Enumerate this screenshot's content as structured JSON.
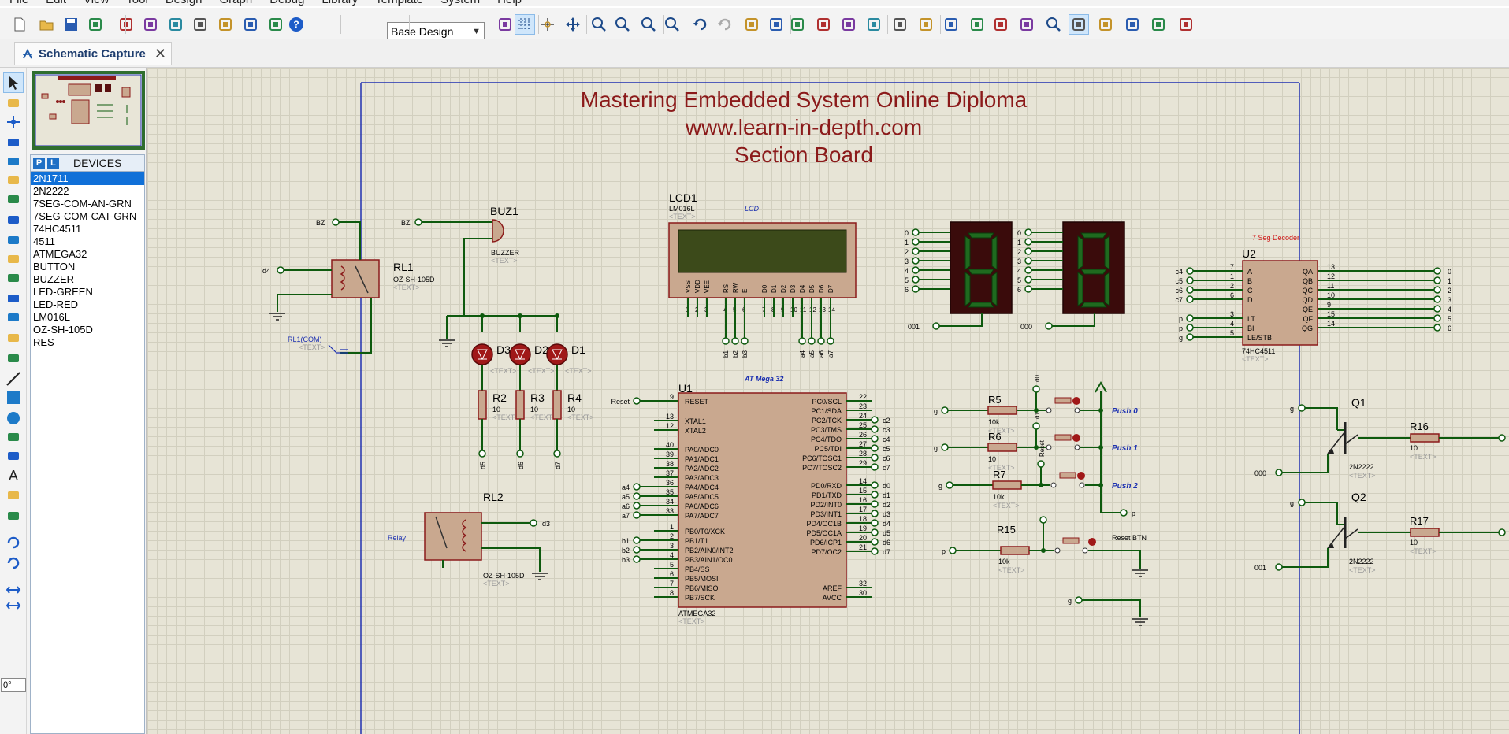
{
  "menu": [
    "File",
    "Edit",
    "View",
    "Tool",
    "Design",
    "Graph",
    "Debug",
    "Library",
    "Template",
    "System",
    "Help"
  ],
  "toolbar": {
    "design_select": "Base Design",
    "icons": [
      "new-file-icon",
      "open-folder-icon",
      "save-icon",
      "import-icon",
      "home-icon",
      "component-icon",
      "audio-icon",
      "bom-icon",
      "price-icon",
      "board-icon",
      "netlist-icon",
      "help-icon",
      "refresh-icon",
      "grid-icon",
      "origin-icon",
      "pan-icon",
      "zoom-in-icon",
      "zoom-out-icon",
      "zoom-fit-icon",
      "zoom-area-icon",
      "undo-icon",
      "redo-icon",
      "cut-icon",
      "copy-icon",
      "paste-icon",
      "block-copy-icon",
      "block-move-icon",
      "block-rotate-icon",
      "block-delete-icon",
      "pick-device-icon",
      "make-device-icon",
      "packaging-icon",
      "decompose-icon",
      "wire-autorouter-icon",
      "search-icon",
      "property-tool-icon",
      "new-sheet-icon",
      "remove-sheet-icon",
      "exit-parent-icon",
      "netlist-to-ares-icon"
    ]
  },
  "tabs": [
    {
      "label": "Schematic Capture"
    }
  ],
  "devices": {
    "header": "DEVICES",
    "p_label": "P",
    "l_label": "L",
    "items": [
      "2N1711",
      "2N2222",
      "7SEG-COM-AN-GRN",
      "7SEG-COM-CAT-GRN",
      "74HC4511",
      "4511",
      "ATMEGA32",
      "BUTTON",
      "BUZZER",
      "LED-GREEN",
      "LED-RED",
      "LM016L",
      "OZ-SH-105D",
      "RES"
    ],
    "selected": "2N1711"
  },
  "left_tools": {
    "angle_value": "0°",
    "icons": [
      "selection-icon",
      "component-mode-icon",
      "junction-dot-icon",
      "wire-label-icon",
      "text-script-icon",
      "bus-icon",
      "subcircuit-icon",
      "terminal-icon",
      "device-pin-icon",
      "graph-icon",
      "tape-recorder-icon",
      "generator-icon",
      "voltage-probe-icon",
      "current-probe-icon",
      "virtual-instrument-icon",
      "line-icon",
      "box-icon",
      "circle-icon",
      "arc-icon",
      "path-icon",
      "text-icon",
      "symbol-icon",
      "marker-icon",
      "rotate-cw-icon",
      "rotate-ccw-icon",
      "mirror-x-icon",
      "mirror-y-icon"
    ]
  },
  "schematic": {
    "title_lines": [
      "Mastering Embedded System Online Diploma",
      "www.learn-in-depth.com",
      "Section Board"
    ],
    "text_placeholder": "<TEXT>",
    "lcd": {
      "ref": "LCD1",
      "part": "LM016L",
      "label": "LCD",
      "pins": [
        "VSS",
        "VDD",
        "VEE",
        "RS",
        "RW",
        "E",
        "D0",
        "D1",
        "D2",
        "D3",
        "D4",
        "D5",
        "D6",
        "D7"
      ],
      "pin_nums": [
        "1",
        "2",
        "3",
        "4",
        "5",
        "6",
        "7",
        "8",
        "9",
        "10",
        "11",
        "12",
        "13",
        "14"
      ],
      "net_labels": [
        "b1",
        "b2",
        "b3",
        "a4",
        "a5",
        "a6",
        "a7"
      ]
    },
    "buzzer": {
      "ref": "BUZ1",
      "part": "BUZZER",
      "net": "BZ"
    },
    "relay1": {
      "ref": "RL1",
      "part": "OZ-SH-105D",
      "in_net": "d4",
      "bz_net": "BZ",
      "com_label": "RL1(COM)"
    },
    "relay2": {
      "ref": "RL2",
      "part": "OZ-SH-105D",
      "label": "Relay",
      "out_net": "d3"
    },
    "leds": [
      {
        "ref": "D3"
      },
      {
        "ref": "D2"
      },
      {
        "ref": "D1"
      }
    ],
    "resistors_led": [
      {
        "ref": "R2",
        "value": "10",
        "net": "d5"
      },
      {
        "ref": "R3",
        "value": "10",
        "net": "d6"
      },
      {
        "ref": "R4",
        "value": "10",
        "net": "d7"
      }
    ],
    "mcu": {
      "ref": "U1",
      "part": "ATMEGA32",
      "label": "AT Mega 32",
      "left_pins": [
        {
          "name": "RESET",
          "num": "9",
          "net": "Reset"
        },
        {
          "name": "XTAL1",
          "num": "13",
          "net": ""
        },
        {
          "name": "XTAL2",
          "num": "12",
          "net": ""
        },
        {
          "name": "PA0/ADC0",
          "num": "40",
          "net": ""
        },
        {
          "name": "PA1/ADC1",
          "num": "39",
          "net": ""
        },
        {
          "name": "PA2/ADC2",
          "num": "38",
          "net": ""
        },
        {
          "name": "PA3/ADC3",
          "num": "37",
          "net": ""
        },
        {
          "name": "PA4/ADC4",
          "num": "36",
          "net": "a4"
        },
        {
          "name": "PA5/ADC5",
          "num": "35",
          "net": "a5"
        },
        {
          "name": "PA6/ADC6",
          "num": "34",
          "net": "a6"
        },
        {
          "name": "PA7/ADC7",
          "num": "33",
          "net": "a7"
        },
        {
          "name": "PB0/T0/XCK",
          "num": "1",
          "net": ""
        },
        {
          "name": "PB1/T1",
          "num": "2",
          "net": "b1"
        },
        {
          "name": "PB2/AIN0/INT2",
          "num": "3",
          "net": "b2"
        },
        {
          "name": "PB3/AIN1/OC0",
          "num": "4",
          "net": "b3"
        },
        {
          "name": "PB4/SS",
          "num": "5",
          "net": ""
        },
        {
          "name": "PB5/MOSI",
          "num": "6",
          "net": ""
        },
        {
          "name": "PB6/MISO",
          "num": "7",
          "net": ""
        },
        {
          "name": "PB7/SCK",
          "num": "8",
          "net": ""
        }
      ],
      "right_pins": [
        {
          "name": "PC0/SCL",
          "num": "22",
          "net": ""
        },
        {
          "name": "PC1/SDA",
          "num": "23",
          "net": ""
        },
        {
          "name": "PC2/TCK",
          "num": "24",
          "net": "c2"
        },
        {
          "name": "PC3/TMS",
          "num": "25",
          "net": "c3"
        },
        {
          "name": "PC4/TDO",
          "num": "26",
          "net": "c4"
        },
        {
          "name": "PC5/TDI",
          "num": "27",
          "net": "c5"
        },
        {
          "name": "PC6/TOSC1",
          "num": "28",
          "net": "c6"
        },
        {
          "name": "PC7/TOSC2",
          "num": "29",
          "net": "c7"
        },
        {
          "name": "PD0/RXD",
          "num": "14",
          "net": "d0"
        },
        {
          "name": "PD1/TXD",
          "num": "15",
          "net": "d1"
        },
        {
          "name": "PD2/INT0",
          "num": "16",
          "net": "d2"
        },
        {
          "name": "PD3/INT1",
          "num": "17",
          "net": "d3"
        },
        {
          "name": "PD4/OC1B",
          "num": "18",
          "net": "d4"
        },
        {
          "name": "PD5/OC1A",
          "num": "19",
          "net": "d5"
        },
        {
          "name": "PD6/ICP1",
          "num": "20",
          "net": "d6"
        },
        {
          "name": "PD7/OC2",
          "num": "21",
          "net": "d7"
        },
        {
          "name": "AREF",
          "num": "32",
          "net": ""
        },
        {
          "name": "AVCC",
          "num": "30",
          "net": ""
        }
      ]
    },
    "seven_seg": {
      "pins": [
        "0",
        "1",
        "2",
        "3",
        "4",
        "5",
        "6"
      ],
      "common_nets": [
        "001",
        "000"
      ]
    },
    "decoder": {
      "ref": "U2",
      "part": "74HC4511",
      "label": "7 Seg Decoder",
      "left_pins": [
        {
          "name": "A",
          "num": "7",
          "net": "c4"
        },
        {
          "name": "B",
          "num": "1",
          "net": "c5"
        },
        {
          "name": "C",
          "num": "2",
          "net": "c6"
        },
        {
          "name": "D",
          "num": "6",
          "net": "c7"
        },
        {
          "name": "LT",
          "num": "3",
          "net": "p"
        },
        {
          "name": "BI",
          "num": "4",
          "net": "p"
        },
        {
          "name": "LE/STB",
          "num": "5",
          "net": "g"
        }
      ],
      "right_pins": [
        {
          "name": "QA",
          "num": "13",
          "net": "0"
        },
        {
          "name": "QB",
          "num": "12",
          "net": "1"
        },
        {
          "name": "QC",
          "num": "11",
          "net": "2"
        },
        {
          "name": "QD",
          "num": "10",
          "net": "3"
        },
        {
          "name": "QE",
          "num": "9",
          "net": "4"
        },
        {
          "name": "QF",
          "num": "15",
          "net": "5"
        },
        {
          "name": "QG",
          "num": "14",
          "net": "6"
        }
      ]
    },
    "buttons": [
      {
        "res_ref": "R5",
        "res_value": "10k",
        "label": "Push 0",
        "net": "g",
        "wire_label": "d0"
      },
      {
        "res_ref": "R6",
        "res_value": "10",
        "label": "Push 1",
        "net": "g",
        "wire_label": "d1"
      },
      {
        "res_ref": "R7",
        "res_value": "10k",
        "label": "Push 2",
        "net": "g",
        "wire_label": "Reset"
      }
    ],
    "reset_btn": {
      "res_ref": "R15",
      "res_value": "10k",
      "label": "Reset BTN",
      "net": "p"
    },
    "p_net": "p",
    "g_net": "g",
    "transistors": [
      {
        "ref": "Q1",
        "part": "2N2222",
        "base_net": "g",
        "emitter_net": "000",
        "res_ref": "R16",
        "res_value": "10"
      },
      {
        "ref": "Q2",
        "part": "2N2222",
        "base_net": "g",
        "emitter_net": "001",
        "res_ref": "R17",
        "res_value": "10"
      }
    ]
  },
  "colors": {
    "canvas": "#e7e4d6",
    "component_body": "#c9a88f",
    "component_outline": "#8b1a1a",
    "wire": "#0e5a0e",
    "title_text": "#8b1a1a",
    "label_blue": "#1b2fb0",
    "selection_blue": "#1070d8"
  }
}
